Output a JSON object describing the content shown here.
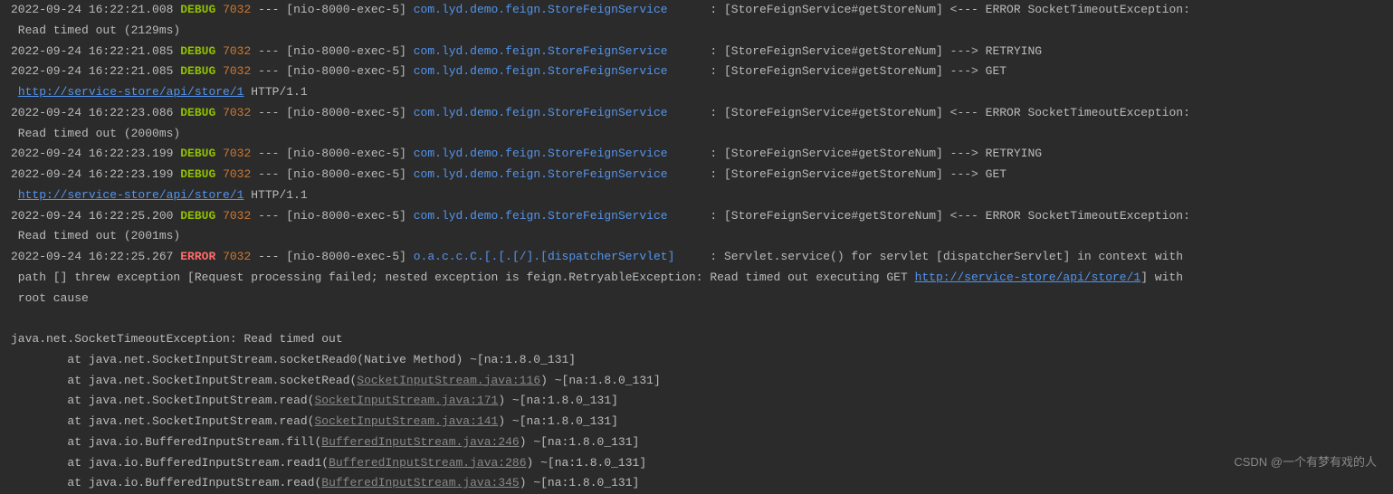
{
  "logs": [
    {
      "ts": "2022-09-24 16:22:21.008",
      "lvl": "DEBUG",
      "pid": "7032",
      "th": "[nio-8000-exec-5]",
      "lg": "com.lyd.demo.feign.StoreFeignService",
      "pre": ": [StoreFeignService#getStoreNum] <--- ERROR SocketTimeoutException:",
      "cont": " Read timed out (2129ms)"
    },
    {
      "ts": "2022-09-24 16:22:21.085",
      "lvl": "DEBUG",
      "pid": "7032",
      "th": "[nio-8000-exec-5]",
      "lg": "com.lyd.demo.feign.StoreFeignService",
      "pre": ": [StoreFeignService#getStoreNum] ---> RETRYING"
    },
    {
      "ts": "2022-09-24 16:22:21.085",
      "lvl": "DEBUG",
      "pid": "7032",
      "th": "[nio-8000-exec-5]",
      "lg": "com.lyd.demo.feign.StoreFeignService",
      "pre": ": [StoreFeignService#getStoreNum] ---> GET",
      "link": "http://service-store/api/store/1",
      "post": " HTTP/1.1"
    },
    {
      "ts": "2022-09-24 16:22:23.086",
      "lvl": "DEBUG",
      "pid": "7032",
      "th": "[nio-8000-exec-5]",
      "lg": "com.lyd.demo.feign.StoreFeignService",
      "pre": ": [StoreFeignService#getStoreNum] <--- ERROR SocketTimeoutException:",
      "cont": " Read timed out (2000ms)"
    },
    {
      "ts": "2022-09-24 16:22:23.199",
      "lvl": "DEBUG",
      "pid": "7032",
      "th": "[nio-8000-exec-5]",
      "lg": "com.lyd.demo.feign.StoreFeignService",
      "pre": ": [StoreFeignService#getStoreNum] ---> RETRYING"
    },
    {
      "ts": "2022-09-24 16:22:23.199",
      "lvl": "DEBUG",
      "pid": "7032",
      "th": "[nio-8000-exec-5]",
      "lg": "com.lyd.demo.feign.StoreFeignService",
      "pre": ": [StoreFeignService#getStoreNum] ---> GET",
      "link": "http://service-store/api/store/1",
      "post": " HTTP/1.1"
    },
    {
      "ts": "2022-09-24 16:22:25.200",
      "lvl": "DEBUG",
      "pid": "7032",
      "th": "[nio-8000-exec-5]",
      "lg": "com.lyd.demo.feign.StoreFeignService",
      "pre": ": [StoreFeignService#getStoreNum] <--- ERROR SocketTimeoutException:",
      "cont": " Read timed out (2001ms)"
    },
    {
      "ts": "2022-09-24 16:22:25.267",
      "lvl": "ERROR",
      "pid": "7032",
      "th": "[nio-8000-exec-5]",
      "lg": "o.a.c.c.C.[.[.[/].[dispatcherServlet]",
      "pre": ": Servlet.service() for servlet [dispatcherServlet] in context with",
      "cont": " path [] threw exception [Request processing failed; nested exception is feign.RetryableException: Read timed out executing GET ",
      "link2": "http://service-store/api/store/1",
      "post2": "] with",
      "cont2": " root cause"
    }
  ],
  "blank": "",
  "exception": "java.net.SocketTimeoutException: Read timed out",
  "stack": [
    {
      "pre": "\tat java.net.SocketInputStream.socketRead0(Native Method) ~[na:1.8.0_131]"
    },
    {
      "pre": "\tat java.net.SocketInputStream.socketRead(",
      "link": "SocketInputStream.java:116",
      "post": ") ~[na:1.8.0_131]"
    },
    {
      "pre": "\tat java.net.SocketInputStream.read(",
      "link": "SocketInputStream.java:171",
      "post": ") ~[na:1.8.0_131]"
    },
    {
      "pre": "\tat java.net.SocketInputStream.read(",
      "link": "SocketInputStream.java:141",
      "post": ") ~[na:1.8.0_131]"
    },
    {
      "pre": "\tat java.io.BufferedInputStream.fill(",
      "link": "BufferedInputStream.java:246",
      "post": ") ~[na:1.8.0_131]"
    },
    {
      "pre": "\tat java.io.BufferedInputStream.read1(",
      "link": "BufferedInputStream.java:286",
      "post": ") ~[na:1.8.0_131]"
    },
    {
      "pre": "\tat java.io.BufferedInputStream.read(",
      "link": "BufferedInputStream.java:345",
      "post": ") ~[na:1.8.0_131]"
    }
  ],
  "watermark": "CSDN @一个有梦有戏的人"
}
